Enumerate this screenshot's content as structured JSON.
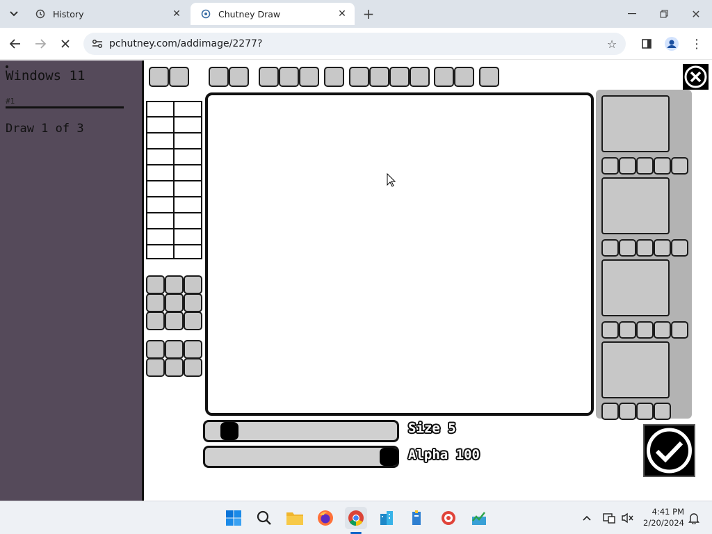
{
  "browser": {
    "tabs": [
      {
        "label": "History",
        "icon": "history-icon"
      },
      {
        "label": "Chutney Draw",
        "icon": "chutney-favicon-icon"
      }
    ],
    "url": "pchutney.com/addimage/2277?"
  },
  "sidebar": {
    "title": "Windows 11",
    "number": "#1",
    "progress": "Draw 1 of 3"
  },
  "size_slider": {
    "label": "Size 5",
    "value": 5
  },
  "alpha_slider": {
    "label": "Alpha 100",
    "value": 100
  },
  "taskbar": {
    "time": "4:41 PM",
    "date": "2/20/2024"
  }
}
